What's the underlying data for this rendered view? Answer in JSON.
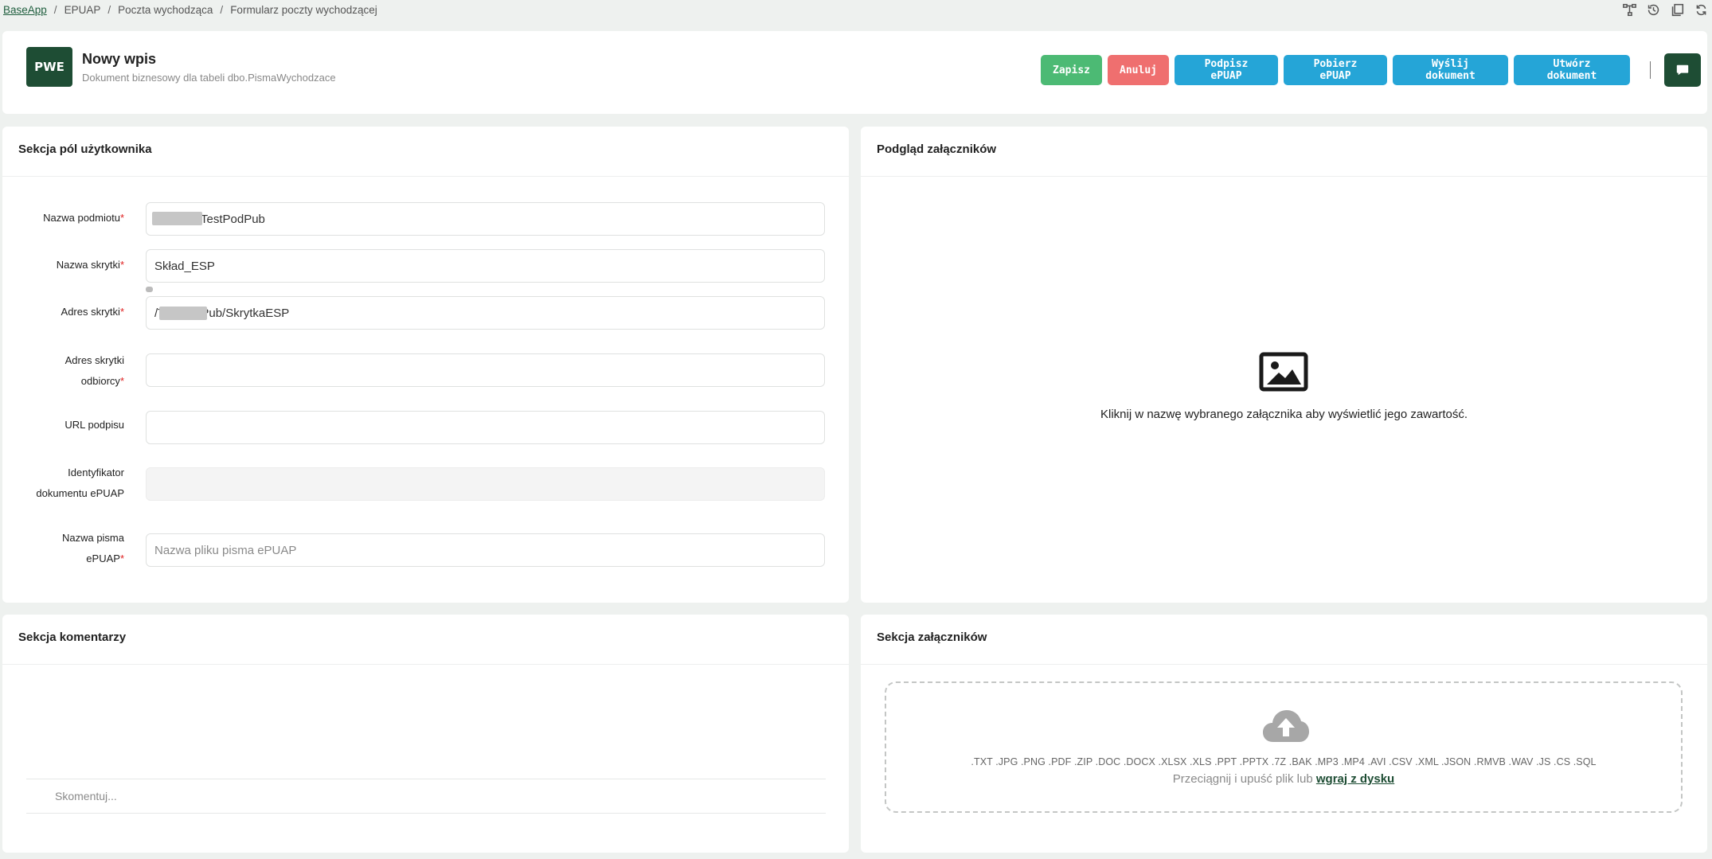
{
  "breadcrumb": {
    "items": [
      "BaseApp",
      "EPUAP",
      "Poczta wychodząca",
      "Formularz poczty wychodzącej"
    ],
    "separator": "/"
  },
  "top_icons": [
    "diagram-icon",
    "history-icon",
    "documents-icon",
    "refresh-icon"
  ],
  "header": {
    "badge": "PWE",
    "title": "Nowy wpis",
    "subtitle": "Dokument biznesowy dla tabeli dbo.PismaWychodzace"
  },
  "actions": {
    "save": "Zapisz",
    "cancel": "Anuluj",
    "sign": "Podpisz ePUAP",
    "fetch": "Pobierz ePUAP",
    "send": "Wyślij dokument",
    "create": "Utwórz dokument"
  },
  "form": {
    "title": "Sekcja pól użytkownika",
    "required_mark": "*",
    "fields": [
      {
        "label": "Nazwa podmiotu",
        "required": true,
        "value": "TestPodPub",
        "placeholder": ""
      },
      {
        "label": "Nazwa skrytki",
        "required": true,
        "value": "Skład_ESP",
        "placeholder": ""
      },
      {
        "label": "Adres skrytki",
        "required": true,
        "value": "/TestPodPub/SkrytkaESP",
        "placeholder": ""
      },
      {
        "label_line1": "Adres skrytki",
        "label_line2": "odbiorcy",
        "required": true,
        "value": "",
        "placeholder": ""
      },
      {
        "label": "URL podpisu",
        "required": false,
        "value": "",
        "placeholder": ""
      },
      {
        "label_line1": "Identyfikator",
        "label_line2": "dokumentu ePUAP",
        "required": false,
        "value": "",
        "placeholder": "",
        "disabled": true
      },
      {
        "label_line1": "Nazwa pisma",
        "label_line2": "ePUAP",
        "required": true,
        "value": "",
        "placeholder": "Nazwa pliku pisma ePUAP"
      }
    ]
  },
  "preview": {
    "title": "Podgląd załączników",
    "message": "Kliknij w nazwę wybranego załącznika aby wyświetlić jego zawartość."
  },
  "comments": {
    "title": "Sekcja komentarzy",
    "placeholder": "Skomentuj..."
  },
  "attachments": {
    "title": "Sekcja załączników",
    "extensions": ".TXT .JPG .PNG .PDF .ZIP .DOC .DOCX .XLSX .XLS .PPT .PPTX .7Z .BAK .MP3 .MP4 .AVI .CSV .XML .JSON .RMVB .WAV .JS .CS .SQL",
    "drop_text": "Przeciągnij i upuść plik lub ",
    "upload_link": "wgraj z dysku"
  },
  "colors": {
    "brand": "#1e4d34",
    "save": "#4cba74",
    "cancel": "#ef6f6f",
    "action": "#25a5d7",
    "required": "#e02020"
  }
}
